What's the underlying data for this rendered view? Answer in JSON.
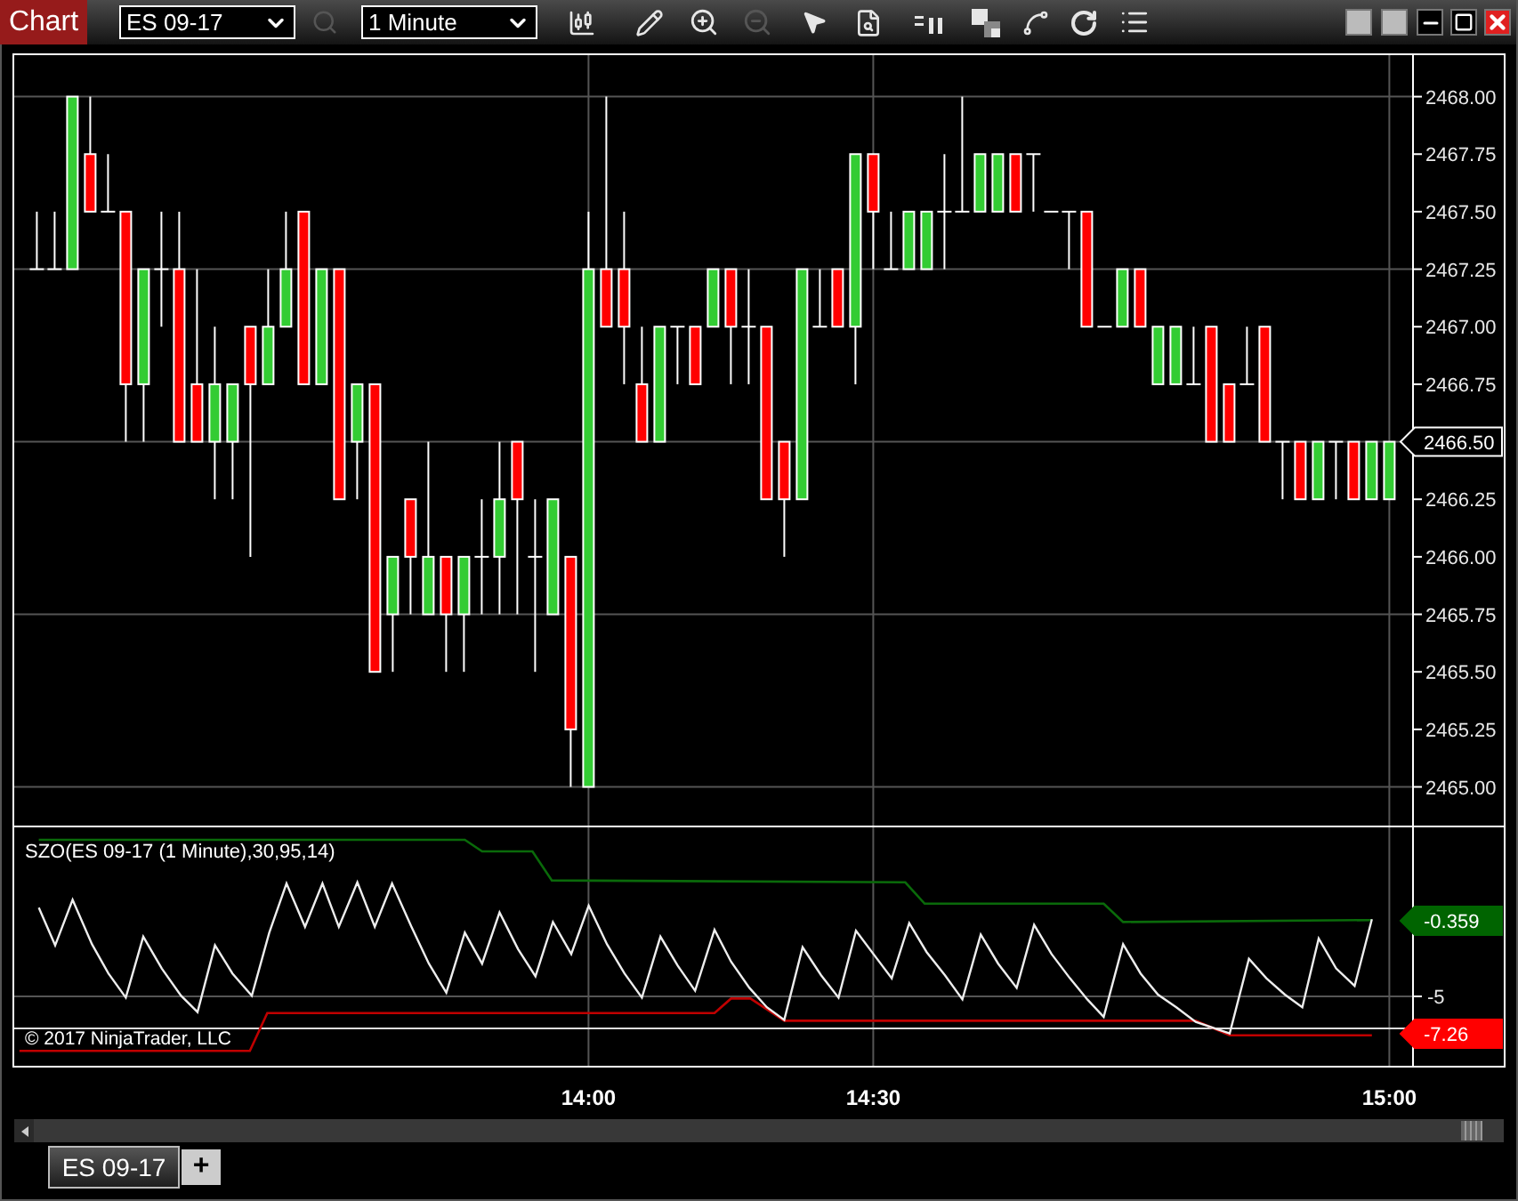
{
  "toolbar": {
    "title": "Chart",
    "instrument": "ES 09-17",
    "interval": "1 Minute"
  },
  "price_axis": [
    {
      "label": "2468.00",
      "current": false
    },
    {
      "label": "2467.75",
      "current": false
    },
    {
      "label": "2467.50",
      "current": false
    },
    {
      "label": "2467.25",
      "current": false
    },
    {
      "label": "2467.00",
      "current": false
    },
    {
      "label": "2466.75",
      "current": false
    },
    {
      "label": "2466.50",
      "current": true
    },
    {
      "label": "2466.25",
      "current": false
    },
    {
      "label": "2466.00",
      "current": false
    },
    {
      "label": "2465.75",
      "current": false
    },
    {
      "label": "2465.50",
      "current": false
    },
    {
      "label": "2465.25",
      "current": false
    },
    {
      "label": "2465.00",
      "current": false
    }
  ],
  "indicator_panel": {
    "label": "SZO(ES 09-17 (1 Minute),30,95,14)",
    "copyright": "© 2017 NinjaTrader, LLC",
    "axis_label": "-5",
    "markers": [
      {
        "value": "-0.359",
        "color": "#006400"
      },
      {
        "value": "-7.26",
        "color": "#ff0000"
      }
    ]
  },
  "time_axis": [
    "14:00",
    "14:30",
    "15:00"
  ],
  "tabs": [
    {
      "label": "ES 09-17",
      "selected": true
    }
  ],
  "add_tab": "+"
}
